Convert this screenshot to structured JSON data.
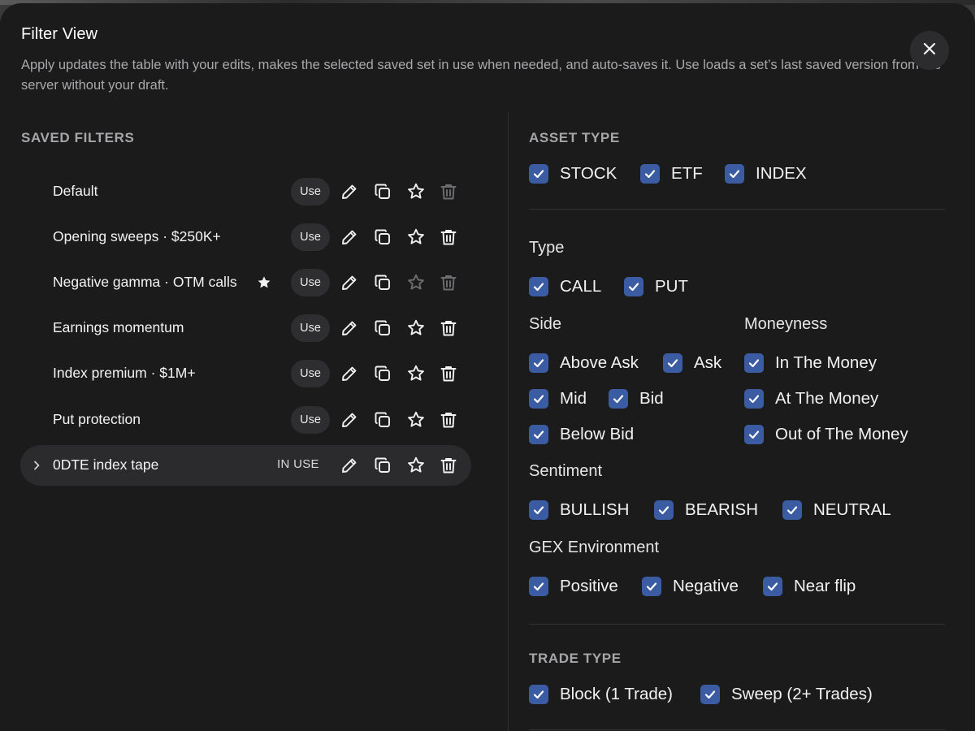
{
  "modal": {
    "title": "Filter View",
    "description": "Apply updates the table with your edits, makes the selected saved set in use when needed, and auto-saves it. Use loads a set’s last saved version from the server without your draft.",
    "close_icon": "close-icon"
  },
  "saved_filters": {
    "title": "SAVED FILTERS",
    "use_label": "Use",
    "in_use_label": "IN USE",
    "items": [
      {
        "name": "Default",
        "favorite": false,
        "active": false,
        "actions_dimmed": true
      },
      {
        "name": "Opening sweeps · $250K+",
        "favorite": false,
        "active": false,
        "actions_dimmed": false
      },
      {
        "name": "Negative gamma · OTM calls",
        "favorite": true,
        "active": false,
        "actions_dimmed": true
      },
      {
        "name": "Earnings momentum",
        "favorite": false,
        "active": false,
        "actions_dimmed": false
      },
      {
        "name": "Index premium · $1M+",
        "favorite": false,
        "active": false,
        "actions_dimmed": false
      },
      {
        "name": "Put protection",
        "favorite": false,
        "active": false,
        "actions_dimmed": false
      },
      {
        "name": "0DTE index tape",
        "favorite": false,
        "active": true,
        "actions_dimmed": false
      }
    ]
  },
  "asset_type": {
    "title": "ASSET TYPE",
    "options": [
      {
        "label": "STOCK",
        "checked": true
      },
      {
        "label": "ETF",
        "checked": true
      },
      {
        "label": "INDEX",
        "checked": true
      }
    ]
  },
  "type": {
    "title": "Type",
    "options": [
      {
        "label": "CALL",
        "checked": true
      },
      {
        "label": "PUT",
        "checked": true
      }
    ]
  },
  "side": {
    "title": "Side",
    "options": [
      {
        "label": "Above Ask",
        "checked": true
      },
      {
        "label": "Ask",
        "checked": true
      },
      {
        "label": "Mid",
        "checked": true
      },
      {
        "label": "Bid",
        "checked": true
      },
      {
        "label": "Below Bid",
        "checked": true
      }
    ]
  },
  "moneyness": {
    "title": "Moneyness",
    "options": [
      {
        "label": "In The Money",
        "checked": true
      },
      {
        "label": "At The Money",
        "checked": true
      },
      {
        "label": "Out of The Money",
        "checked": true
      }
    ]
  },
  "sentiment": {
    "title": "Sentiment",
    "options": [
      {
        "label": "BULLISH",
        "checked": true
      },
      {
        "label": "BEARISH",
        "checked": true
      },
      {
        "label": "NEUTRAL",
        "checked": true
      }
    ]
  },
  "gex": {
    "title": "GEX Environment",
    "options": [
      {
        "label": "Positive",
        "checked": true
      },
      {
        "label": "Negative",
        "checked": true
      },
      {
        "label": "Near flip",
        "checked": true
      }
    ]
  },
  "trade_type": {
    "title": "TRADE TYPE",
    "options": [
      {
        "label": "Block (1 Trade)",
        "checked": true
      },
      {
        "label": "Sweep (2+ Trades)",
        "checked": true
      }
    ]
  },
  "colors": {
    "modal_bg": "#1b1b1c",
    "checkbox_fill": "#3b5ca3",
    "text_primary": "#f2f2f2",
    "text_muted": "#a6a6a8"
  }
}
